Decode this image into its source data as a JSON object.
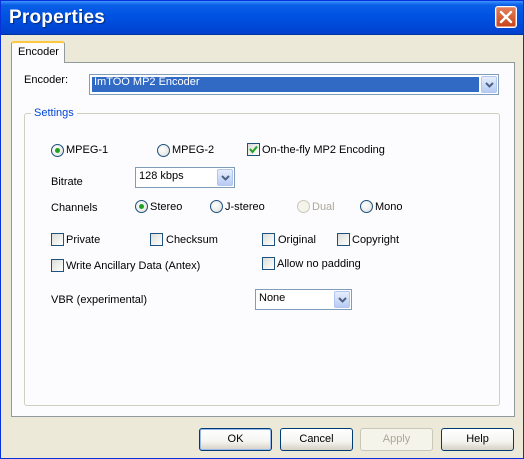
{
  "window": {
    "title": "Properties"
  },
  "tabs": [
    {
      "label": "Encoder"
    }
  ],
  "encoder": {
    "label": "Encoder:",
    "value": "ImTOO MP2 Encoder"
  },
  "settings": {
    "legend": "Settings",
    "format": {
      "mpeg1": "MPEG-1",
      "mpeg2": "MPEG-2",
      "selected": "MPEG-1"
    },
    "onthefly": {
      "label": "On-the-fly MP2 Encoding",
      "checked": true
    },
    "bitrate": {
      "label": "Bitrate",
      "value": "128 kbps"
    },
    "channels": {
      "label": "Channels",
      "stereo": "Stereo",
      "jstereo": "J-stereo",
      "dual": "Dual",
      "mono": "Mono",
      "selected": "Stereo"
    },
    "flags": {
      "private": "Private",
      "checksum": "Checksum",
      "original": "Original",
      "copyright": "Copyright",
      "ancillary": "Write Ancillary Data (Antex)",
      "nopadding": "Allow no padding"
    },
    "vbr": {
      "label": "VBR (experimental)",
      "value": "None"
    }
  },
  "buttons": {
    "ok": "OK",
    "cancel": "Cancel",
    "apply": "Apply",
    "help": "Help"
  },
  "colors": {
    "titlebar": "#0054e3",
    "accent_tab": "#ffc83c",
    "selection": "#316ac5",
    "radio_dot": "#21a121",
    "check_mark": "#21a121"
  }
}
